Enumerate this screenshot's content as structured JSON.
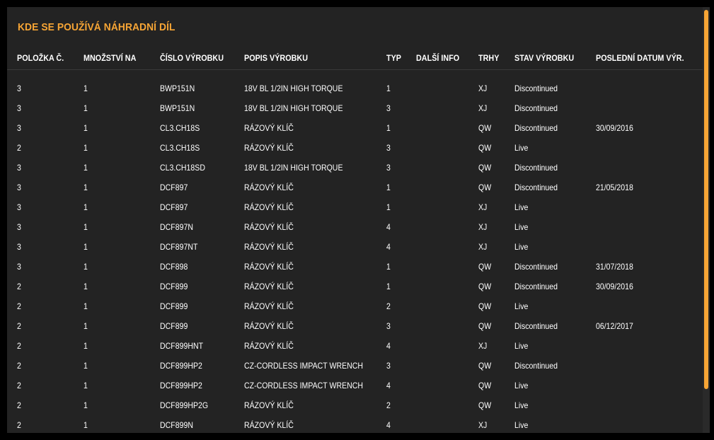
{
  "title": "KDE SE POUŽÍVÁ NÁHRADNÍ DÍL",
  "columns": [
    "POLOŽKA Č.",
    "MNOŽSTVÍ NA",
    "ČÍSLO VÝROBKU",
    "POPIS VÝROBKU",
    "TYP",
    "DALŠÍ INFO",
    "TRHY",
    "STAV VÝROBKU",
    "POSLEDNÍ DATUM VÝR."
  ],
  "rows": [
    [
      "3",
      "1",
      "BWP151N",
      "18V BL 1/2IN HIGH TORQUE",
      "1",
      "",
      "XJ",
      "Discontinued",
      ""
    ],
    [
      "3",
      "1",
      "BWP151N",
      "18V BL 1/2IN HIGH TORQUE",
      "3",
      "",
      "XJ",
      "Discontinued",
      ""
    ],
    [
      "3",
      "1",
      "CL3.CH18S",
      "RÁZOVÝ KLÍČ",
      "1",
      "",
      "QW",
      "Discontinued",
      "30/09/2016"
    ],
    [
      "2",
      "1",
      "CL3.CH18S",
      "RÁZOVÝ KLÍČ",
      "3",
      "",
      "QW",
      "Live",
      ""
    ],
    [
      "3",
      "1",
      "CL3.CH18SD",
      "18V BL 1/2IN HIGH TORQUE",
      "3",
      "",
      "QW",
      "Discontinued",
      ""
    ],
    [
      "3",
      "1",
      "DCF897",
      "RÁZOVÝ KLÍČ",
      "1",
      "",
      "QW",
      "Discontinued",
      "21/05/2018"
    ],
    [
      "3",
      "1",
      "DCF897",
      "RÁZOVÝ KLÍČ",
      "1",
      "",
      "XJ",
      "Live",
      ""
    ],
    [
      "3",
      "1",
      "DCF897N",
      "RÁZOVÝ KLÍČ",
      "4",
      "",
      "XJ",
      "Live",
      ""
    ],
    [
      "3",
      "1",
      "DCF897NT",
      "RÁZOVÝ KLÍČ",
      "4",
      "",
      "XJ",
      "Live",
      ""
    ],
    [
      "3",
      "1",
      "DCF898",
      "RÁZOVÝ KLÍČ",
      "1",
      "",
      "QW",
      "Discontinued",
      "31/07/2018"
    ],
    [
      "2",
      "1",
      "DCF899",
      "RÁZOVÝ KLÍČ",
      "1",
      "",
      "QW",
      "Discontinued",
      "30/09/2016"
    ],
    [
      "2",
      "1",
      "DCF899",
      "RÁZOVÝ KLÍČ",
      "2",
      "",
      "QW",
      "Live",
      ""
    ],
    [
      "2",
      "1",
      "DCF899",
      "RÁZOVÝ KLÍČ",
      "3",
      "",
      "QW",
      "Discontinued",
      "06/12/2017"
    ],
    [
      "2",
      "1",
      "DCF899HNT",
      "RÁZOVÝ KLÍČ",
      "4",
      "",
      "XJ",
      "Live",
      ""
    ],
    [
      "2",
      "1",
      "DCF899HP2",
      "CZ-CORDLESS IMPACT WRENCH",
      "3",
      "",
      "QW",
      "Discontinued",
      ""
    ],
    [
      "2",
      "1",
      "DCF899HP2",
      "CZ-CORDLESS IMPACT WRENCH",
      "4",
      "",
      "QW",
      "Live",
      ""
    ],
    [
      "2",
      "1",
      "DCF899HP2G",
      "RÁZOVÝ KLÍČ",
      "2",
      "",
      "QW",
      "Live",
      ""
    ],
    [
      "2",
      "1",
      "DCF899N",
      "RÁZOVÝ KLÍČ",
      "4",
      "",
      "XJ",
      "Live",
      ""
    ]
  ],
  "colors": {
    "accent": "#f7a535",
    "panel": "#232323",
    "backdrop": "#000000",
    "text": "#ffffff"
  }
}
